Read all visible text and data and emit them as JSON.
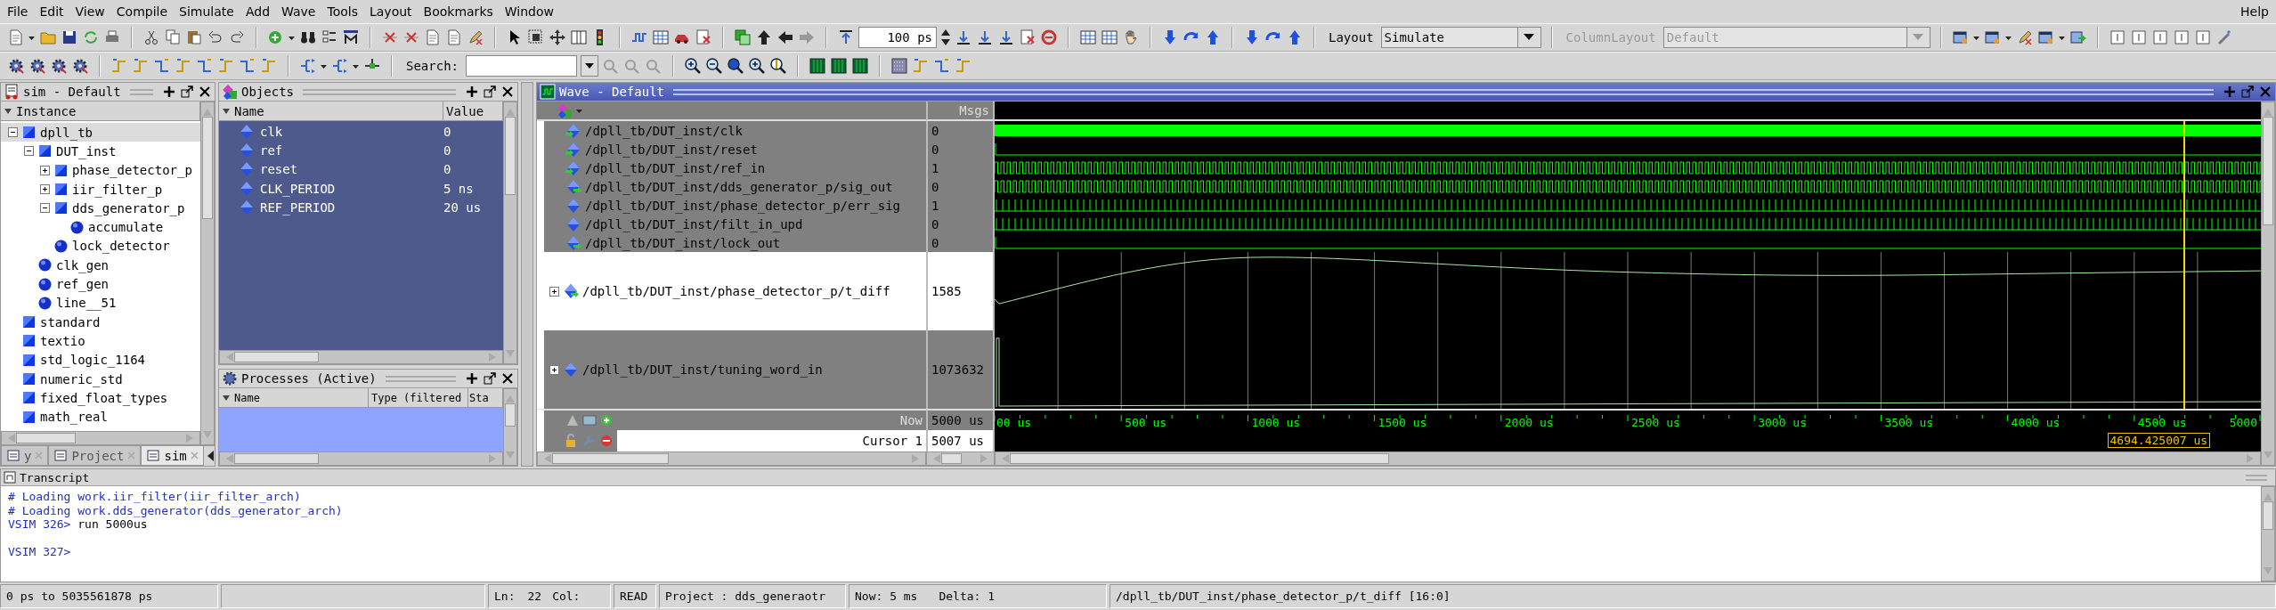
{
  "menu": {
    "items": [
      "File",
      "Edit",
      "View",
      "Compile",
      "Simulate",
      "Add",
      "Wave",
      "Tools",
      "Layout",
      "Bookmarks",
      "Window"
    ],
    "help": "Help"
  },
  "toolbar": {
    "run_length": "100 ps",
    "layout": {
      "label": "Layout",
      "value": "Simulate"
    },
    "column_layout": {
      "label": "ColumnLayout",
      "value": "Default",
      "disabled": true
    },
    "search": {
      "label": "Search:"
    }
  },
  "sim_panel": {
    "title": "sim - Default",
    "column": "Instance",
    "tree": [
      {
        "label": "dpll_tb",
        "kind": "module",
        "selected": true,
        "expanded": true,
        "children": [
          {
            "label": "DUT_inst",
            "kind": "module",
            "selected": false,
            "expanded": true,
            "children": [
              {
                "label": "phase_detector_p",
                "kind": "module",
                "selected": false,
                "expanded": false
              },
              {
                "label": "iir_filter_p",
                "kind": "module",
                "selected": false,
                "expanded": false
              },
              {
                "label": "dds_generator_p",
                "kind": "module",
                "selected": false,
                "expanded": true,
                "children": [
                  {
                    "label": "accumulate",
                    "kind": "process",
                    "selected": false
                  }
                ]
              },
              {
                "label": "lock_detector",
                "kind": "process",
                "selected": false
              }
            ]
          },
          {
            "label": "clk_gen",
            "kind": "process",
            "selected": false
          },
          {
            "label": "ref_gen",
            "kind": "process",
            "selected": false
          },
          {
            "label": "line__51",
            "kind": "process",
            "selected": false
          }
        ]
      },
      {
        "label": "standard",
        "kind": "module",
        "selected": false
      },
      {
        "label": "textio",
        "kind": "module",
        "selected": false
      },
      {
        "label": "std_logic_1164",
        "kind": "module",
        "selected": false
      },
      {
        "label": "numeric_std",
        "kind": "module",
        "selected": false
      },
      {
        "label": "fixed_float_types",
        "kind": "module",
        "selected": false
      },
      {
        "label": "math_real",
        "kind": "module",
        "selected": false
      }
    ],
    "tabs": [
      {
        "label": "y",
        "selected": false
      },
      {
        "label": "Project",
        "selected": false
      },
      {
        "label": "sim",
        "selected": true
      }
    ]
  },
  "objects_panel": {
    "title": "Objects",
    "columns": [
      "Name",
      "Value"
    ],
    "rows": [
      {
        "name": "clk",
        "value": "0"
      },
      {
        "name": "ref",
        "value": "0"
      },
      {
        "name": "reset",
        "value": "0"
      },
      {
        "name": "CLK_PERIOD",
        "value": "5 ns"
      },
      {
        "name": "REF_PERIOD",
        "value": "20 us"
      }
    ]
  },
  "processes_panel": {
    "title": "Processes (Active)",
    "columns": [
      "Name",
      "Type (filtered",
      "Sta"
    ]
  },
  "wave": {
    "title": "Wave - Default",
    "msgs_header": "Msgs",
    "signals": [
      {
        "name": "/dpll_tb/DUT_inst/clk",
        "value": "0",
        "kind": "dense",
        "input": true,
        "output": false,
        "selected": true
      },
      {
        "name": "/dpll_tb/DUT_inst/reset",
        "value": "0",
        "kind": "low",
        "input": true,
        "output": false,
        "selected": true
      },
      {
        "name": "/dpll_tb/DUT_inst/ref_in",
        "value": "1",
        "kind": "square",
        "input": true,
        "output": false,
        "selected": true
      },
      {
        "name": "/dpll_tb/DUT_inst/dds_generator_p/sig_out",
        "value": "0",
        "kind": "square",
        "input": false,
        "output": true,
        "selected": true
      },
      {
        "name": "/dpll_tb/DUT_inst/phase_detector_p/err_sig",
        "value": "1",
        "kind": "pulses",
        "input": false,
        "output": false,
        "selected": true
      },
      {
        "name": "/dpll_tb/DUT_inst/filt_in_upd",
        "value": "0",
        "kind": "pulses",
        "input": false,
        "output": false,
        "selected": true
      },
      {
        "name": "/dpll_tb/DUT_inst/lock_out",
        "value": "0",
        "kind": "low",
        "input": false,
        "output": true,
        "selected": true
      },
      {
        "name": "/dpll_tb/DUT_inst/phase_detector_p/t_diff",
        "value": "1585",
        "kind": "analog_hump",
        "input": false,
        "output": true,
        "selected": false,
        "expanded": false
      },
      {
        "name": "/dpll_tb/DUT_inst/tuning_word_in",
        "value": "1073632",
        "kind": "analog_ramp",
        "input": false,
        "output": false,
        "selected": true,
        "expanded": false
      }
    ],
    "now_label": "Now",
    "now_value": "5000 us",
    "cursor_label": "Cursor 1",
    "cursor_value": "5007 us",
    "time_ticks": [
      "00 us",
      "500 us",
      "1000 us",
      "1500 us",
      "2000 us",
      "2500 us",
      "3000 us",
      "3500 us",
      "4000 us",
      "4500 us",
      "5000"
    ],
    "cursor_time": "4694.425007 us"
  },
  "transcript": {
    "title": "Transcript",
    "lines": [
      {
        "kind": "comment",
        "text": "# Loading work.iir_filter(iir_filter_arch)"
      },
      {
        "kind": "comment",
        "text": "# Loading work.dds_generator(dds_generator_arch)"
      },
      {
        "kind": "prompt",
        "prompt": "VSIM 326>",
        "command": "run 5000us"
      },
      {
        "kind": "blank"
      },
      {
        "kind": "prompt",
        "prompt": "VSIM 327>"
      }
    ]
  },
  "status_bar": {
    "range": "0 ps to 5035561878 ps",
    "line_label": "Ln:",
    "line": "22",
    "col_label": "Col:",
    "mode": "READ",
    "project": "Project : dds_generaotr",
    "now": "Now: 5 ms",
    "delta": "Delta: 1",
    "path": "/dpll_tb/DUT_inst/phase_detector_p/t_diff [16:0]"
  }
}
